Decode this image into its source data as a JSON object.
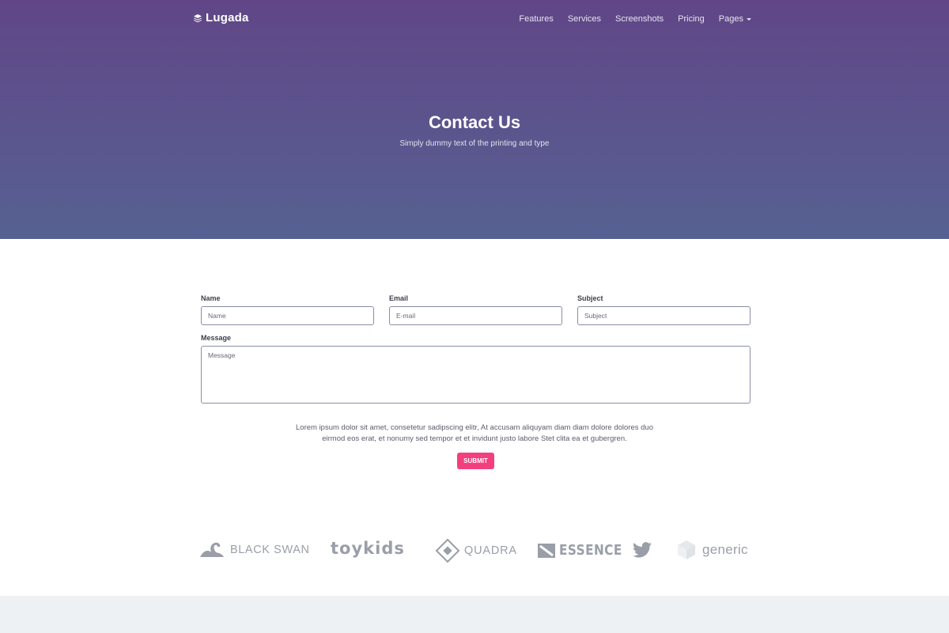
{
  "brand": {
    "name": "Lugada",
    "icon": "layers-icon"
  },
  "nav": {
    "items": [
      {
        "label": "Features"
      },
      {
        "label": "Services"
      },
      {
        "label": "Screenshots"
      },
      {
        "label": "Pricing"
      },
      {
        "label": "Pages",
        "has_dropdown": true
      }
    ]
  },
  "hero": {
    "title": "Contact Us",
    "subtitle": "Simply dummy text of the printing and type"
  },
  "form": {
    "name": {
      "label": "Name",
      "placeholder": "Name",
      "value": ""
    },
    "email": {
      "label": "Email",
      "placeholder": "E-mail",
      "value": ""
    },
    "subject": {
      "label": "Subject",
      "placeholder": "Subject",
      "value": ""
    },
    "message": {
      "label": "Message",
      "placeholder": "Message",
      "value": ""
    },
    "legal_line1": "Lorem ipsum dolor sit amet, consetetur sadipscing elitr, At accusam aliquyam diam diam dolore dolores duo",
    "legal_line2": "eirmod eos erat, et nonumy sed tempor et et invidunt justo labore Stet clita ea et gubergren.",
    "submit_label": "SUBMIT"
  },
  "clients": [
    {
      "name": "BLACK SWAN",
      "icon": "swan-icon"
    },
    {
      "name": "toykids",
      "icon": ""
    },
    {
      "name": "QUADRA",
      "icon": "diamond-square-icon"
    },
    {
      "name": "ESSENCE",
      "icon": "flag-icon"
    },
    {
      "name": "",
      "icon": "twitter-bird-icon"
    },
    {
      "name": "generic",
      "icon": "cube-icon"
    }
  ],
  "colors": {
    "hero_top": "#614687",
    "hero_bottom": "#566192",
    "accent": "#f2407e",
    "logo_gray": "#9a9ea8",
    "footer_bg": "#eef1f4"
  }
}
